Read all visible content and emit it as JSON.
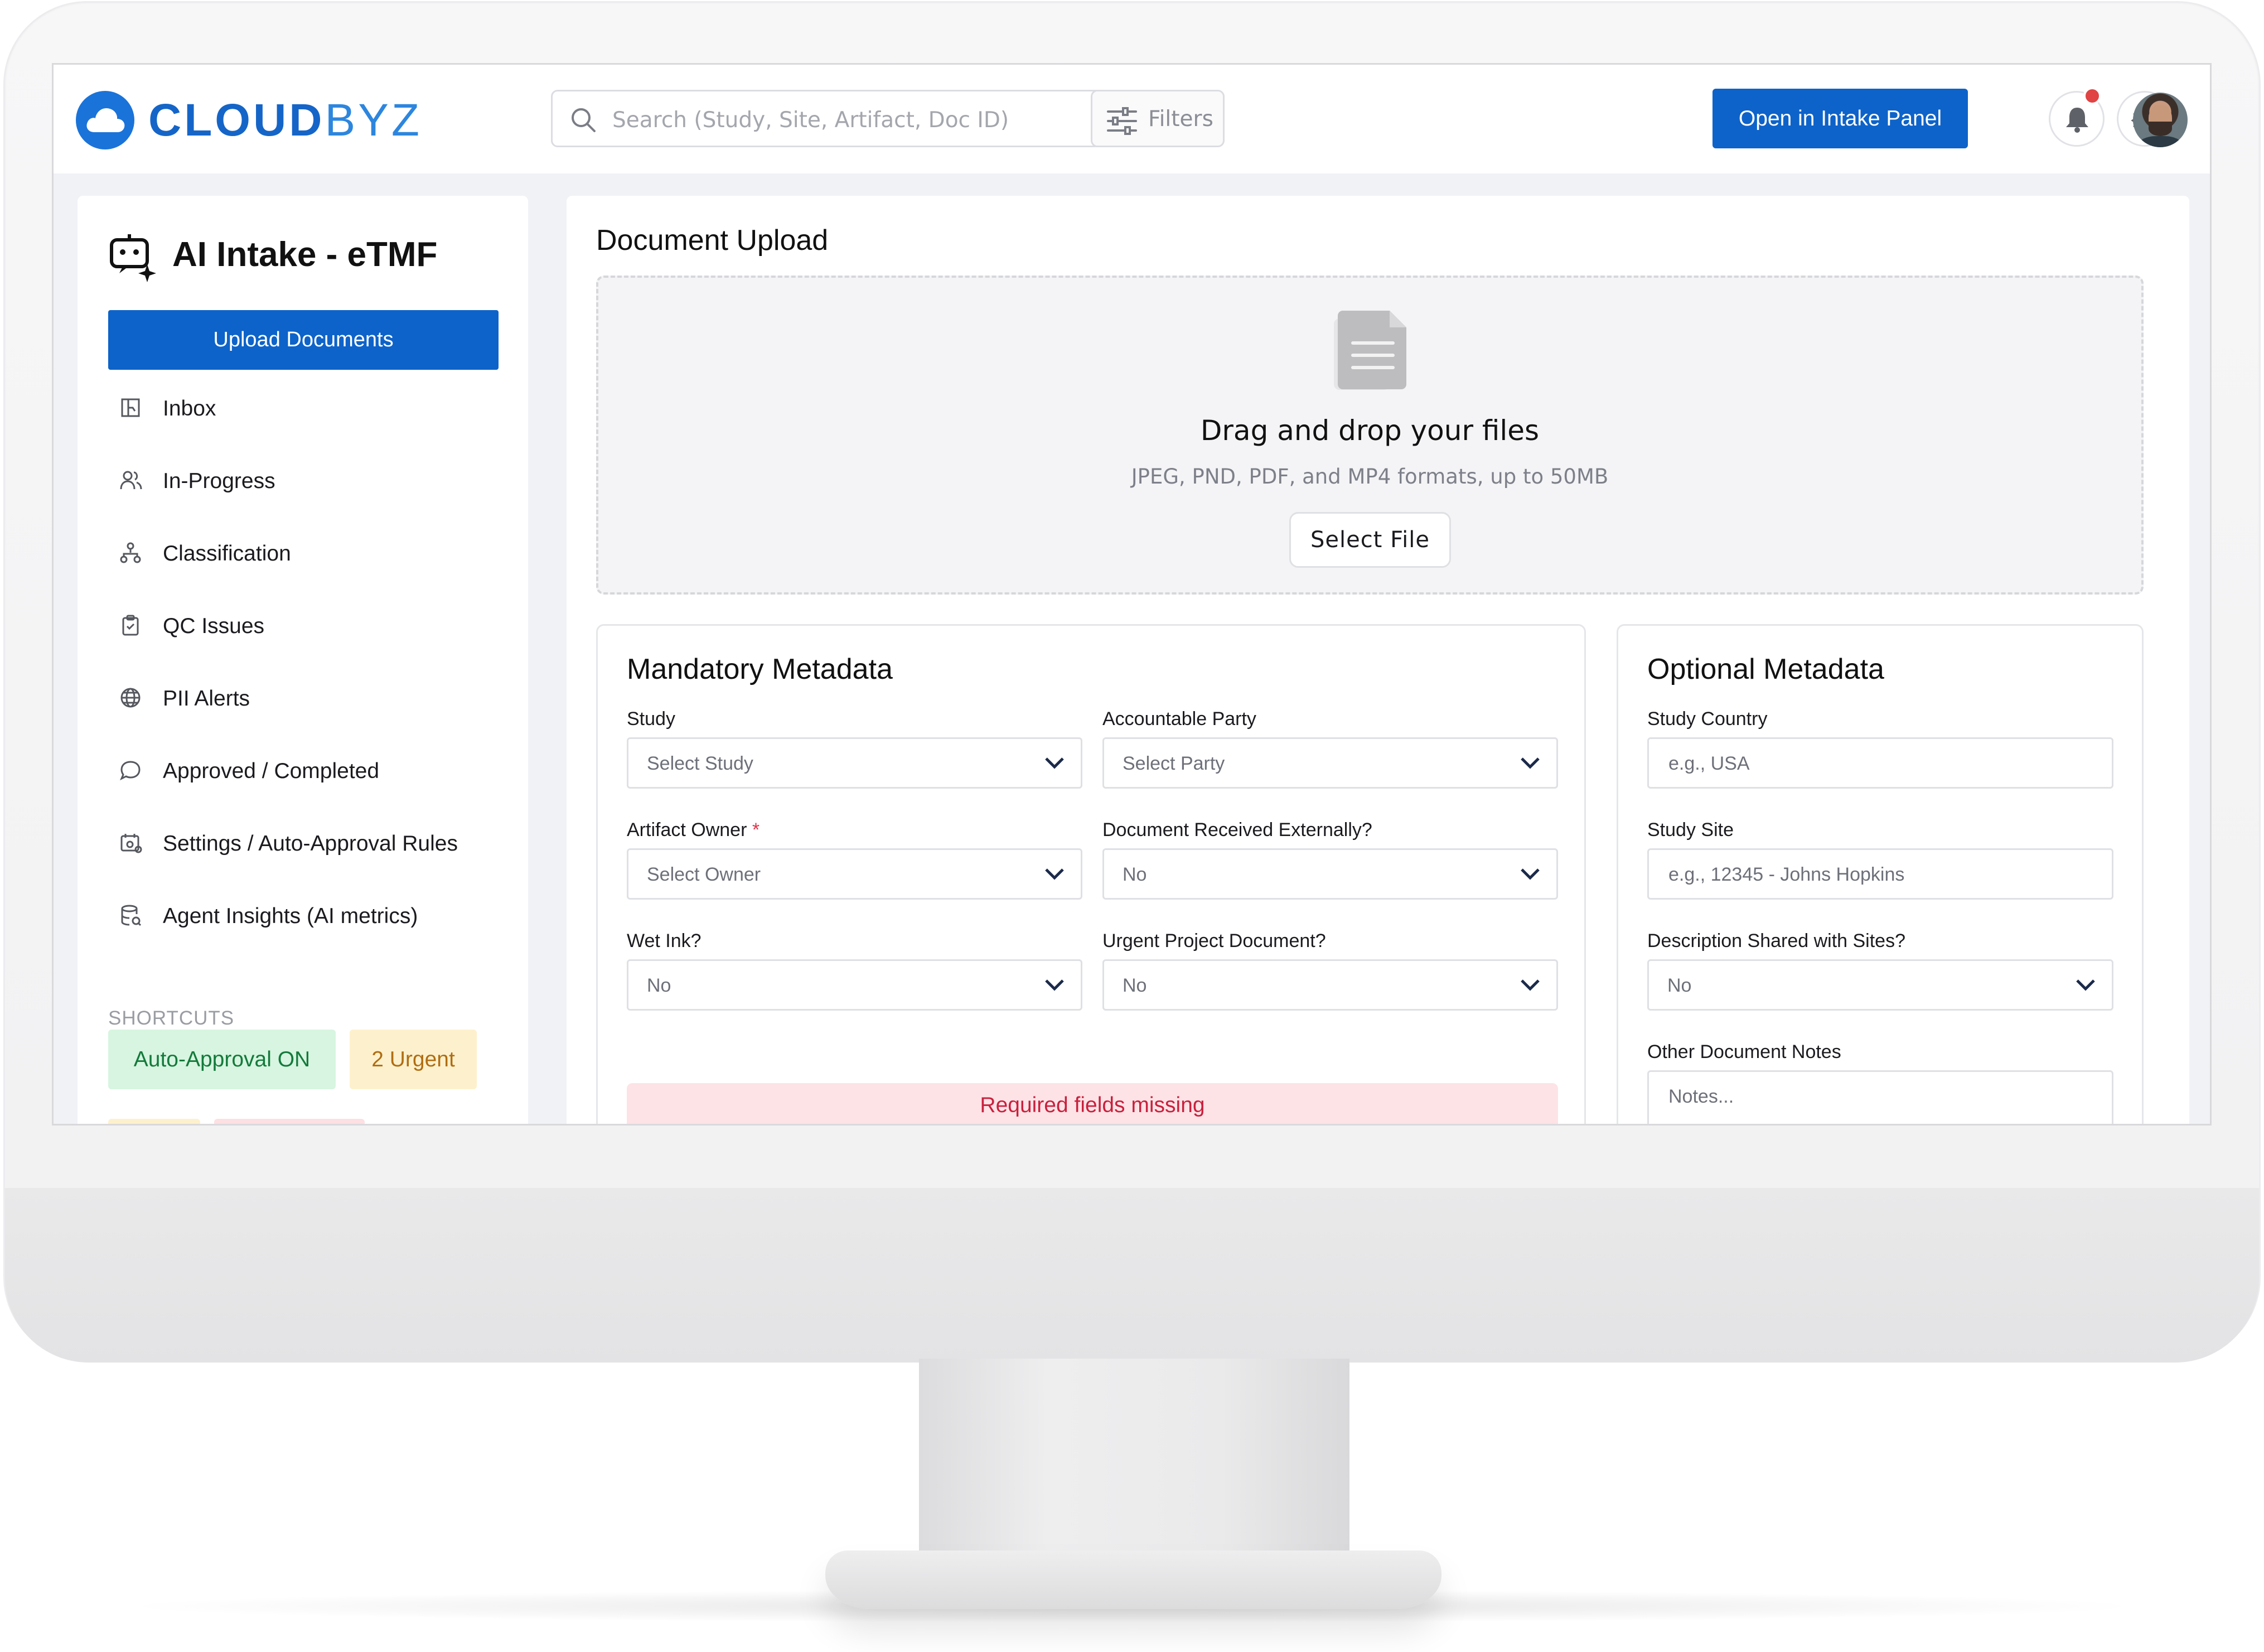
{
  "brand": {
    "logo_part1": "CLOUD",
    "logo_part2": "BYZ",
    "primary_color": "#0d63c9"
  },
  "topbar": {
    "search_placeholder": "Search (Study, Site, Artifact, Doc ID)",
    "filters_label": "Filters",
    "open_button": "Open in Intake Panel"
  },
  "sidebar": {
    "title": "AI Intake - eTMF",
    "upload_button": "Upload Documents",
    "items": [
      {
        "label": "Inbox",
        "icon": "inbox-icon"
      },
      {
        "label": "In-Progress",
        "icon": "users-icon"
      },
      {
        "label": "Classification",
        "icon": "hierarchy-icon"
      },
      {
        "label": "QC Issues",
        "icon": "clipboard-icon"
      },
      {
        "label": "PII Alerts",
        "icon": "globe-icon"
      },
      {
        "label": "Approved / Completed",
        "icon": "chat-bubble-icon"
      },
      {
        "label": "Settings / Auto-Approval Rules",
        "icon": "settings-calendar-icon"
      },
      {
        "label": "Agent Insights (AI metrics)",
        "icon": "database-icon"
      }
    ],
    "shortcuts_heading": "SHORTCUTS",
    "shortcuts": [
      "Auto-Approval ON",
      "2 Urgent"
    ]
  },
  "main": {
    "title": "Document Upload",
    "dropzone": {
      "title": "Drag and drop your files",
      "subtitle": "JPEG, PND, PDF, and MP4 formats, up to 50MB",
      "button": "Select File"
    },
    "mandatory": {
      "title": "Mandatory Metadata",
      "fields": {
        "study": {
          "label": "Study",
          "value": "Select Study"
        },
        "accountable_party": {
          "label": "Accountable Party",
          "value": "Select Party"
        },
        "artifact_owner": {
          "label": "Artifact Owner",
          "required_mark": "*",
          "value": "Select Owner"
        },
        "received_externally": {
          "label": "Document Received Externally?",
          "value": "No"
        },
        "wet_ink": {
          "label": "Wet Ink?",
          "value": "No"
        },
        "urgent_project": {
          "label": "Urgent Project Document?",
          "value": "No"
        }
      },
      "alert": "Required fields missing"
    },
    "optional": {
      "title": "Optional Metadata",
      "fields": {
        "study_country": {
          "label": "Study Country",
          "placeholder": "e.g., USA"
        },
        "study_site": {
          "label": "Study Site",
          "placeholder": "e.g., 12345 - Johns Hopkins"
        },
        "description_shared": {
          "label": "Description Shared with Sites?",
          "value": "No"
        },
        "other_notes": {
          "label": "Other Document Notes",
          "placeholder": "Notes..."
        }
      }
    }
  }
}
